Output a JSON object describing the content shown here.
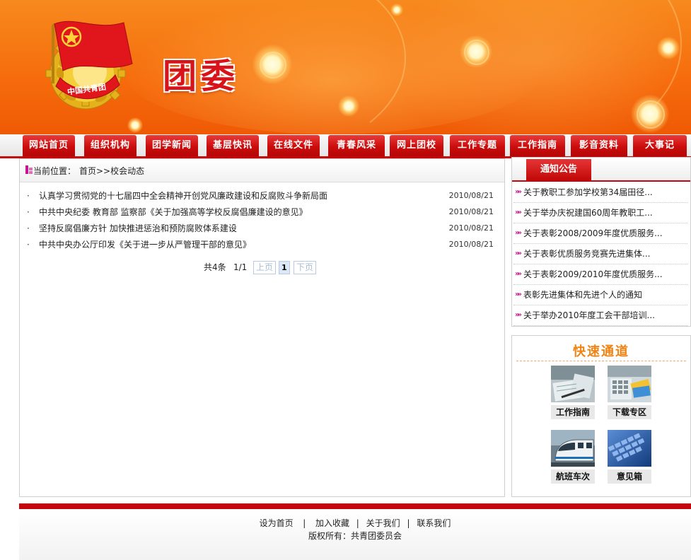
{
  "header": {
    "site_title": "团委",
    "emblem_text": "中国共青团"
  },
  "nav": {
    "items": [
      {
        "label": "网站首页"
      },
      {
        "label": "组织机构"
      },
      {
        "label": "团学新闻"
      },
      {
        "label": "基层快讯"
      },
      {
        "label": "在线文件"
      },
      {
        "label": "青春风采"
      },
      {
        "label": "网上团校"
      },
      {
        "label": "工作专题"
      },
      {
        "label": "工作指南"
      },
      {
        "label": "影音资料"
      },
      {
        "label": "大事记"
      }
    ]
  },
  "breadcrumb": {
    "label": "当前位置：",
    "path": "首页>>校会动态"
  },
  "news": [
    {
      "title": "认真学习贯彻党的十七届四中全会精神开创党风廉政建设和反腐败斗争新局面",
      "date": "2010/08/21"
    },
    {
      "title": "中共中央纪委 教育部 监察部《关于加强高等学校反腐倡廉建设的意见》",
      "date": "2010/08/21"
    },
    {
      "title": "坚持反腐倡廉方针 加快推进惩治和预防腐败体系建设",
      "date": "2010/08/21"
    },
    {
      "title": "中共中央办公厅印发《关于进一步从严管理干部的意见》",
      "date": "2010/08/21"
    }
  ],
  "pager": {
    "total": "共4条",
    "page_info": "1/1",
    "prev": "上页",
    "current": "1",
    "next": "下页"
  },
  "notice": {
    "title": "通知公告",
    "items": [
      {
        "text": "关于教职工参加学校第34届田径..."
      },
      {
        "text": "关于举办庆祝建国60周年教职工..."
      },
      {
        "text": "关于表彰2008/2009年度优质服务..."
      },
      {
        "text": "关于表彰优质服务竞赛先进集体..."
      },
      {
        "text": "关于表彰2009/2010年度优质服务..."
      },
      {
        "text": "表彰先进集体和先进个人的通知"
      },
      {
        "text": "关于举办2010年度工会干部培训..."
      }
    ]
  },
  "quick": {
    "title": "快速通道",
    "items": [
      {
        "label": "工作指南",
        "icon": "work-guide-icon"
      },
      {
        "label": "下载专区",
        "icon": "download-icon"
      },
      {
        "label": "航班车次",
        "icon": "train-icon"
      },
      {
        "label": "意见箱",
        "icon": "keyboard-icon"
      }
    ]
  },
  "footer": {
    "links": [
      "设为首页",
      "加入收藏",
      "关于我们",
      "联系我们"
    ],
    "copyright": "版权所有：共青团委员会"
  },
  "colors": {
    "nav_red": "#c3070b",
    "banner_orange": "#f66b0c",
    "quick_orange": "#f08312",
    "notice_arrow": "#c2188f"
  }
}
